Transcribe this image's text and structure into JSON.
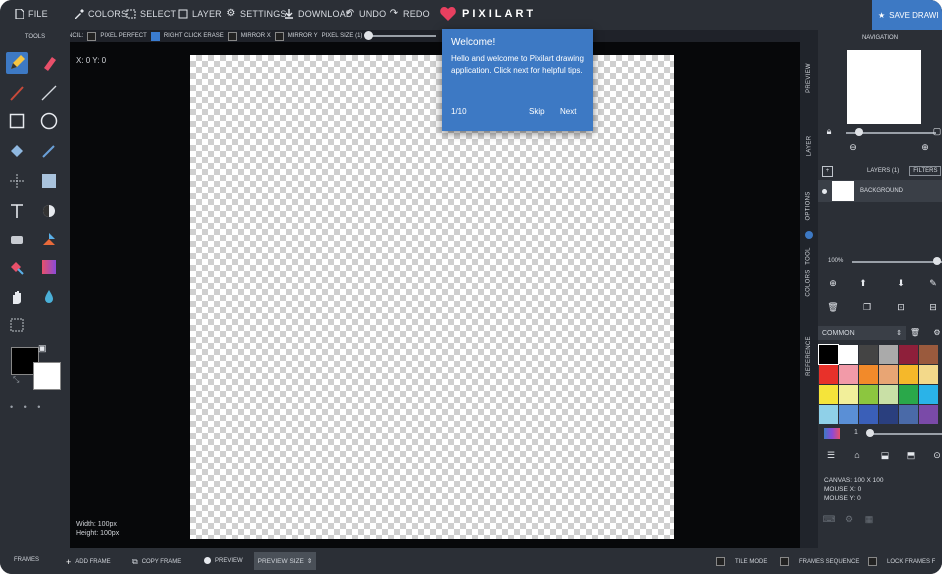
{
  "app": {
    "logo_text": "PIXILART",
    "save_button": "SAVE DRAWI"
  },
  "topbar": {
    "items": [
      {
        "label": "FILE"
      },
      {
        "label": "COLORS"
      },
      {
        "label": "SELECT"
      },
      {
        "label": "LAYER"
      },
      {
        "label": "SETTINGS"
      },
      {
        "label": "DOWNLOAD"
      },
      {
        "label": "UNDO"
      },
      {
        "label": "REDO"
      }
    ]
  },
  "options_bar": {
    "pencil": "PENCIL:",
    "pixel_perfect": "PIXEL PERFECT",
    "right_click_erase": "RIGHT CLICK ERASE",
    "mirror_x": "MIRROR X",
    "mirror_y": "MIRROR Y",
    "pixel_size": "PIXEL SIZE (1)",
    "pixel_perfect_checked": false,
    "right_click_erase_checked": true,
    "mirror_x_checked": false,
    "mirror_y_checked": false
  },
  "tools": {
    "title": "TOOLS",
    "primary_color": "#000000",
    "secondary_color": "#ffffff"
  },
  "canvas": {
    "coords": "X: 0 Y: 0",
    "width_text": "Width: 100px",
    "height_text": "Height: 100px"
  },
  "popup": {
    "title": "Welcome!",
    "body": "Hello and welcome to Pixilart drawing application. Click next for helpful tips.",
    "counter": "1/10",
    "skip": "Skip",
    "next": "Next"
  },
  "right_tabs": [
    "PREVIEW",
    "LAYER",
    "OPTIONS",
    "TOOL",
    "COLORS",
    "REFERENCE"
  ],
  "navigation": {
    "title": "NAVIGATION"
  },
  "layers": {
    "title": "LAYERS (1)",
    "filters": "FILTERS",
    "layer_name": "BACKGROUND",
    "opacity": "100%"
  },
  "palette": {
    "name": "COMMON",
    "colors": [
      "#000000",
      "#ffffff",
      "#444444",
      "#aaaaaa",
      "#8e1f3a",
      "#9a5a3d",
      "#e8312a",
      "#f29aa8",
      "#f28a2a",
      "#e8a574",
      "#f5b82a",
      "#f3d98a",
      "#f5e43a",
      "#f2ef9a",
      "#8cc63f",
      "#c9e0a6",
      "#2aa84a",
      "#2ab3e8",
      "#8fd0e8",
      "#5a8fd6",
      "#3a5fb8",
      "#2a3f7e",
      "#4a6aa8",
      "#7a4aa8"
    ],
    "brush_size": "1"
  },
  "info": {
    "canvas": "CANVAS: 100 X 100",
    "mouse_x": "MOUSE X: 0",
    "mouse_y": "MOUSE Y: 0"
  },
  "bottombar": {
    "frames": "FRAMES",
    "add_frame": "ADD FRAME",
    "copy_frame": "COPY FRAME",
    "preview": "PREVIEW",
    "preview_size": "PREVIEW SIZE",
    "tile_mode": "TILE MODE",
    "frames_sequence": "FRAMES SEQUENCE",
    "lock_frames": "LOCK FRAMES F"
  }
}
